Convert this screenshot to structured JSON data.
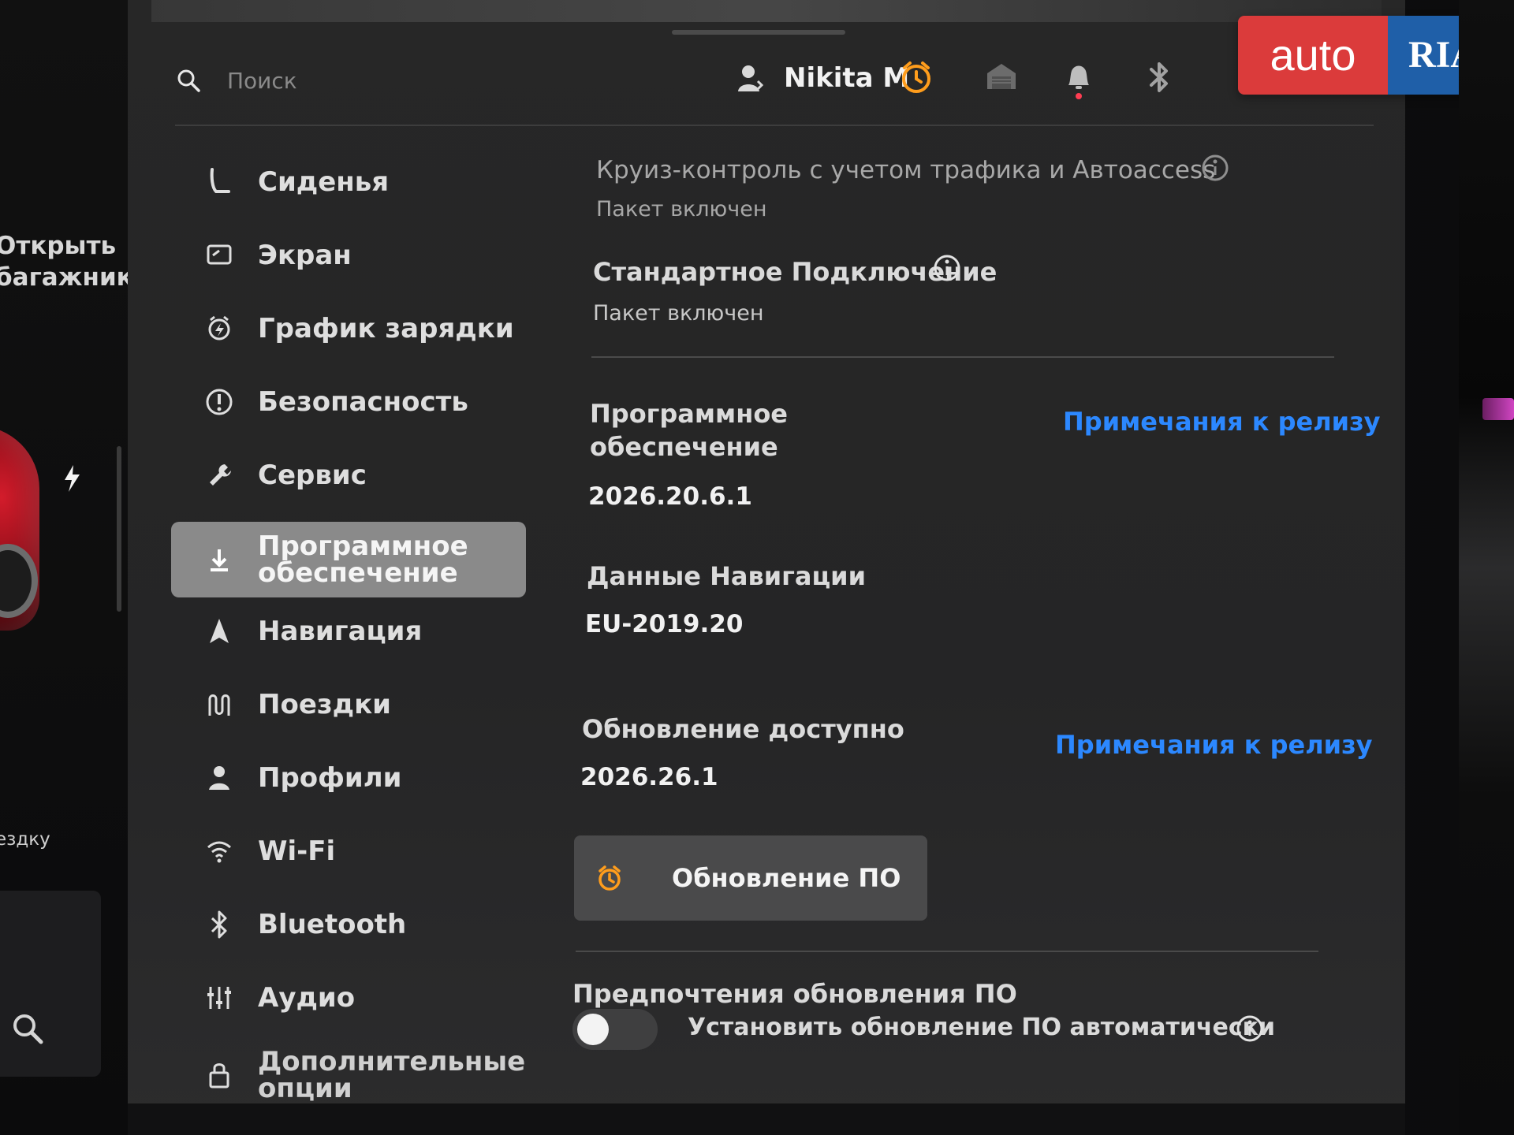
{
  "left_panel": {
    "open_trunk": "Открыть багажник",
    "trip_fragment": "ездку"
  },
  "topbar": {
    "search_placeholder": "Поиск",
    "user_name": "Nikita M"
  },
  "watermark": {
    "left": "auto",
    "right": "RIA"
  },
  "sidebar": {
    "items": [
      {
        "label": "Сиденья",
        "icon": "seat-icon"
      },
      {
        "label": "Экран",
        "icon": "display-icon"
      },
      {
        "label": "График зарядки",
        "icon": "charging-schedule-icon"
      },
      {
        "label": "Безопасность",
        "icon": "safety-icon"
      },
      {
        "label": "Сервис",
        "icon": "wrench-icon"
      },
      {
        "label": "Программное обеспечение",
        "icon": "download-icon"
      },
      {
        "label": "Навигация",
        "icon": "navigation-icon"
      },
      {
        "label": "Поездки",
        "icon": "trips-icon"
      },
      {
        "label": "Профили",
        "icon": "profile-icon"
      },
      {
        "label": "Wi-Fi",
        "icon": "wifi-icon"
      },
      {
        "label": "Bluetooth",
        "icon": "bluetooth-icon"
      },
      {
        "label": "Аудио",
        "icon": "audio-icon"
      },
      {
        "label": "Дополнительные опции",
        "icon": "lock-icon"
      }
    ]
  },
  "content": {
    "cruise_title": "Круиз-контроль с учетом трафика и Автоaccess",
    "cruise_status": "Пакет включен",
    "standard_connection_title": "Стандартное Подключение",
    "standard_connection_status": "Пакет включен",
    "software_title": "Программное обеспечение",
    "release_notes": "Примечания к релизу",
    "software_version": "2026.20.6.1",
    "nav_data_title": "Данные Навигации",
    "nav_data_version": "EU-2019.20",
    "update_available_title": "Обновление доступно",
    "update_available_version": "2026.26.1",
    "update_button": "Обновление ПО",
    "preferences_title": "Предпочтения обновления ПО",
    "auto_install_label": "Установить обновление ПО автоматически"
  },
  "colors": {
    "accent_link": "#2c88ff",
    "alarm_orange": "#ff9d1c",
    "bell_dot": "#ff3d52"
  }
}
